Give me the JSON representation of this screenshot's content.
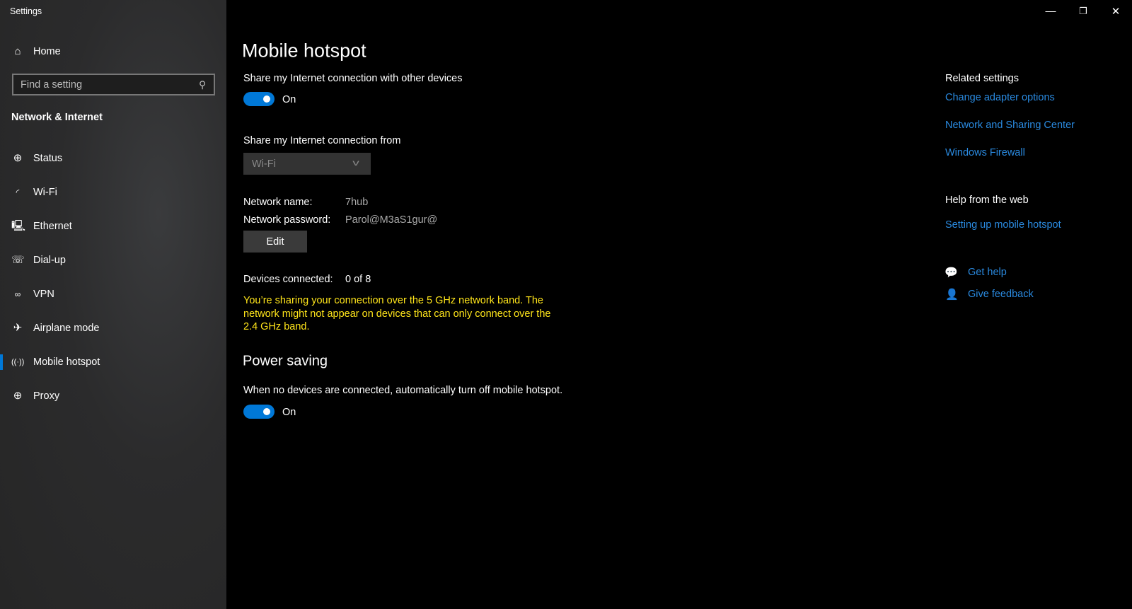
{
  "window": {
    "title": "Settings",
    "controls": {
      "minimize": "—",
      "restore": "❐",
      "close": "✕"
    }
  },
  "sidebar": {
    "home_label": "Home",
    "search_placeholder": "Find a setting",
    "section_title": "Network & Internet",
    "items": [
      {
        "label": "Status",
        "icon": "status-globe-icon"
      },
      {
        "label": "Wi-Fi",
        "icon": "wifi-icon"
      },
      {
        "label": "Ethernet",
        "icon": "ethernet-icon"
      },
      {
        "label": "Dial-up",
        "icon": "dial-up-icon"
      },
      {
        "label": "VPN",
        "icon": "vpn-icon"
      },
      {
        "label": "Airplane mode",
        "icon": "airplane-icon"
      },
      {
        "label": "Mobile hotspot",
        "icon": "hotspot-icon",
        "selected": true
      },
      {
        "label": "Proxy",
        "icon": "globe-icon"
      }
    ]
  },
  "main": {
    "title": "Mobile hotspot",
    "share_label": "Share my Internet connection with other devices",
    "share_toggle": {
      "state": "On"
    },
    "share_from_label": "Share my Internet connection from",
    "share_from_value": "Wi-Fi",
    "network_name_label": "Network name:",
    "network_name": "7hub",
    "network_password_label": "Network password:",
    "network_password": "Parol@M3aS1gur@",
    "edit_label": "Edit",
    "devices_label": "Devices connected:",
    "devices_value": "0 of 8",
    "warning": "You’re sharing your connection over the 5 GHz network band. The network might not appear on devices that can only connect over the 2.4 GHz band.",
    "power_saving_title": "Power saving",
    "power_saving_label": "When no devices are connected, automatically turn off mobile hotspot.",
    "power_toggle": {
      "state": "On"
    }
  },
  "right": {
    "related_title": "Related settings",
    "related_links": [
      "Change adapter options",
      "Network and Sharing Center",
      "Windows Firewall"
    ],
    "help_title": "Help from the web",
    "help_links": [
      "Setting up mobile hotspot"
    ],
    "get_help": "Get help",
    "give_feedback": "Give feedback"
  },
  "colors": {
    "accent": "#0078d7",
    "link": "#2a8ae0",
    "warning": "#ffe51a"
  }
}
